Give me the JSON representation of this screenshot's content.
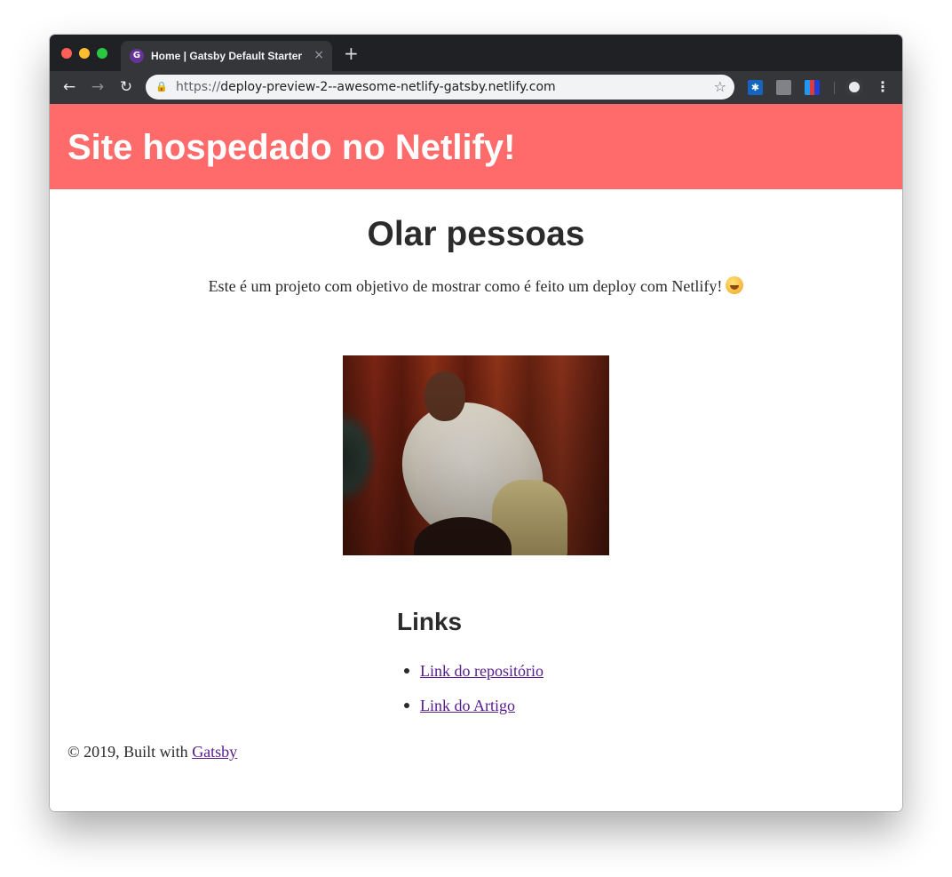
{
  "browser": {
    "tab_title": "Home | Gatsby Default Starter",
    "favicon_glyph": "G",
    "new_tab_symbol": "+",
    "close_tab_symbol": "×",
    "url_scheme": "https://",
    "url_rest": "deploy-preview-2--awesome-netlify-gatsby.netlify.com"
  },
  "site": {
    "header_title": "Site hospedado no Netlify!",
    "heading": "Olar pessoas",
    "intro_text": "Este é um projeto com objetivo de mostrar como é feito um deploy com Netlify!",
    "links_heading": "Links",
    "links": [
      {
        "label": "Link do repositório"
      },
      {
        "label": "Link do Artigo"
      }
    ],
    "footer_prefix": "© 2019, Built with ",
    "footer_link": "Gatsby"
  },
  "colors": {
    "header_bg": "#ff6b6b",
    "link": "#551a8b",
    "text": "#2b2b2b"
  },
  "icons": [
    "back-arrow-icon",
    "forward-arrow-icon",
    "reload-icon",
    "lock-icon",
    "bookmark-star-icon",
    "extension-icon",
    "profile-avatar-icon",
    "more-menu-icon",
    "grinning-face-emoji-icon"
  ]
}
